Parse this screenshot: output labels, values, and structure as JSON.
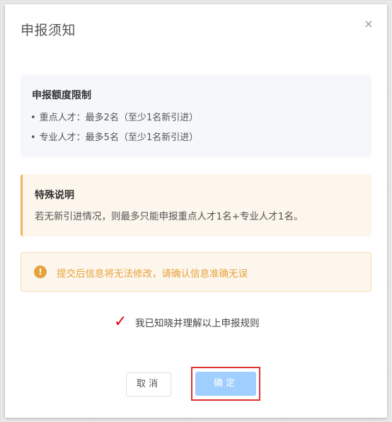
{
  "dialog": {
    "title": "申报须知",
    "close_icon": "close-icon"
  },
  "quota": {
    "title": "申报额度限制",
    "items": [
      {
        "bullet": "•",
        "text": "重点人才：最多2名（至少1名新引进）"
      },
      {
        "bullet": "•",
        "text": "专业人才：最多5名（至少1名新引进）"
      }
    ]
  },
  "special": {
    "title": "特殊说明",
    "text": "若无新引进情况，则最多只能申报重点人才1名+专业人才1名。"
  },
  "warning": {
    "icon": "!",
    "text": "提交后信息将无法修改，请确认信息准确无误"
  },
  "agreement": {
    "checked_mark": "✓",
    "text": "我已知晓并理解以上申报规则"
  },
  "buttons": {
    "cancel": "取消",
    "confirm": "确定"
  },
  "colors": {
    "warning": "#e6a23c",
    "confirm_button": "#a0cfff",
    "checkmark": "#e60012",
    "highlight_frame": "#e0322f"
  }
}
